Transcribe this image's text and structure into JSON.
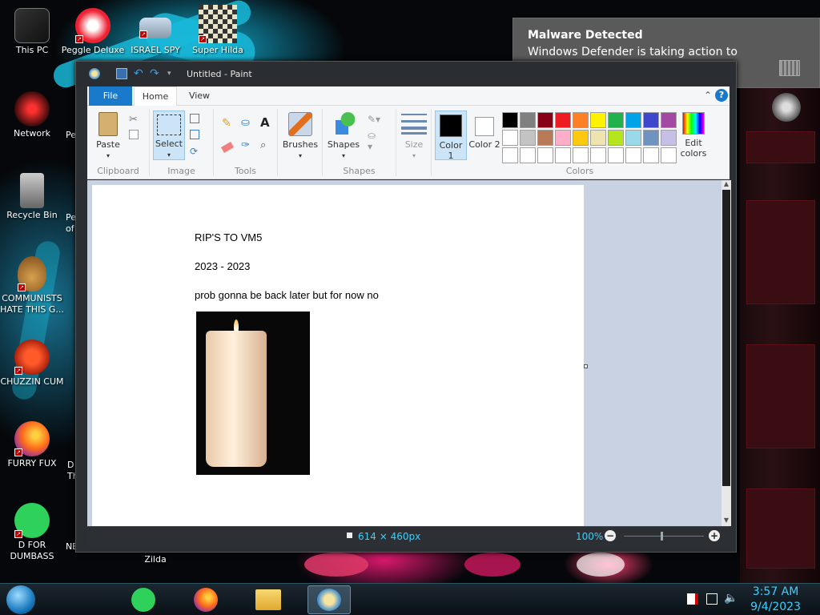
{
  "desktop": {
    "icons": [
      {
        "label": "This PC",
        "icon": "computer-icon"
      },
      {
        "label": "Peggle Deluxe",
        "icon": "peggle-icon"
      },
      {
        "label": "ISRAEL SPY",
        "icon": "spy-icon"
      },
      {
        "label": "Super Hilda",
        "icon": "pixel-game-icon"
      },
      {
        "label": "Network",
        "icon": "network-icon"
      },
      {
        "label": "Recycle Bin",
        "icon": "recycle-bin-icon"
      },
      {
        "label": "COMMUNISTS HATE THIS G...",
        "icon": "money-bag-icon"
      },
      {
        "label": "CHUZZIN CUM",
        "icon": "chuzzle-icon"
      },
      {
        "label": "FURRY FUX",
        "icon": "firefox-icon"
      },
      {
        "label": "D FOR DUMBASS",
        "icon": "chat-app-icon"
      },
      {
        "label": "Zilda",
        "icon": "game-icon"
      }
    ],
    "partial_labels": [
      "Pe",
      "Pe",
      "of",
      "D",
      "Th",
      "NE"
    ]
  },
  "notification": {
    "title": "Malware Detected",
    "body": "Windows Defender is taking action to clean detected malware."
  },
  "paint": {
    "window_title": "Untitled - Paint",
    "tabs": [
      "File",
      "Home",
      "View"
    ],
    "groups": {
      "clipboard": {
        "label": "Clipboard",
        "paste": "Paste"
      },
      "image": {
        "label": "Image",
        "select": "Select"
      },
      "tools": {
        "label": "Tools"
      },
      "brushes": {
        "label": "Brushes"
      },
      "shapes": {
        "label": "Shapes",
        "button": "Shapes"
      },
      "size": {
        "label": "Size"
      },
      "colors": {
        "label": "Colors",
        "color1": "Color 1",
        "color2": "Color 2",
        "edit": "Edit colors"
      }
    },
    "palette_row1": [
      "#000000",
      "#7f7f7f",
      "#880015",
      "#ed1c24",
      "#ff7f27",
      "#fff200",
      "#22b14c",
      "#00a2e8",
      "#3f48cc",
      "#a349a4"
    ],
    "palette_row2": [
      "#ffffff",
      "#c3c3c3",
      "#b97a57",
      "#ffaec9",
      "#ffc90e",
      "#efe4b0",
      "#b5e61d",
      "#99d9ea",
      "#7092be",
      "#c8bfe7"
    ],
    "canvas": {
      "line1": "RIP'S TO VM5",
      "line2": "2023 - 2023",
      "line3": "prob gonna be back later but for now no",
      "image": "candle-photo"
    },
    "status": {
      "dimensions": "614 × 460px",
      "zoom": "100%"
    }
  },
  "taskbar": {
    "apps": [
      "chat-app-icon",
      "firefox-icon",
      "file-explorer-icon",
      "paint-icon"
    ],
    "clock_time": "3:57 AM",
    "clock_date": "9/4/2023"
  },
  "colors": {
    "accent": "#1979ca",
    "teal": "#3ad0ff",
    "toast_bg": "#5a5a5a"
  }
}
